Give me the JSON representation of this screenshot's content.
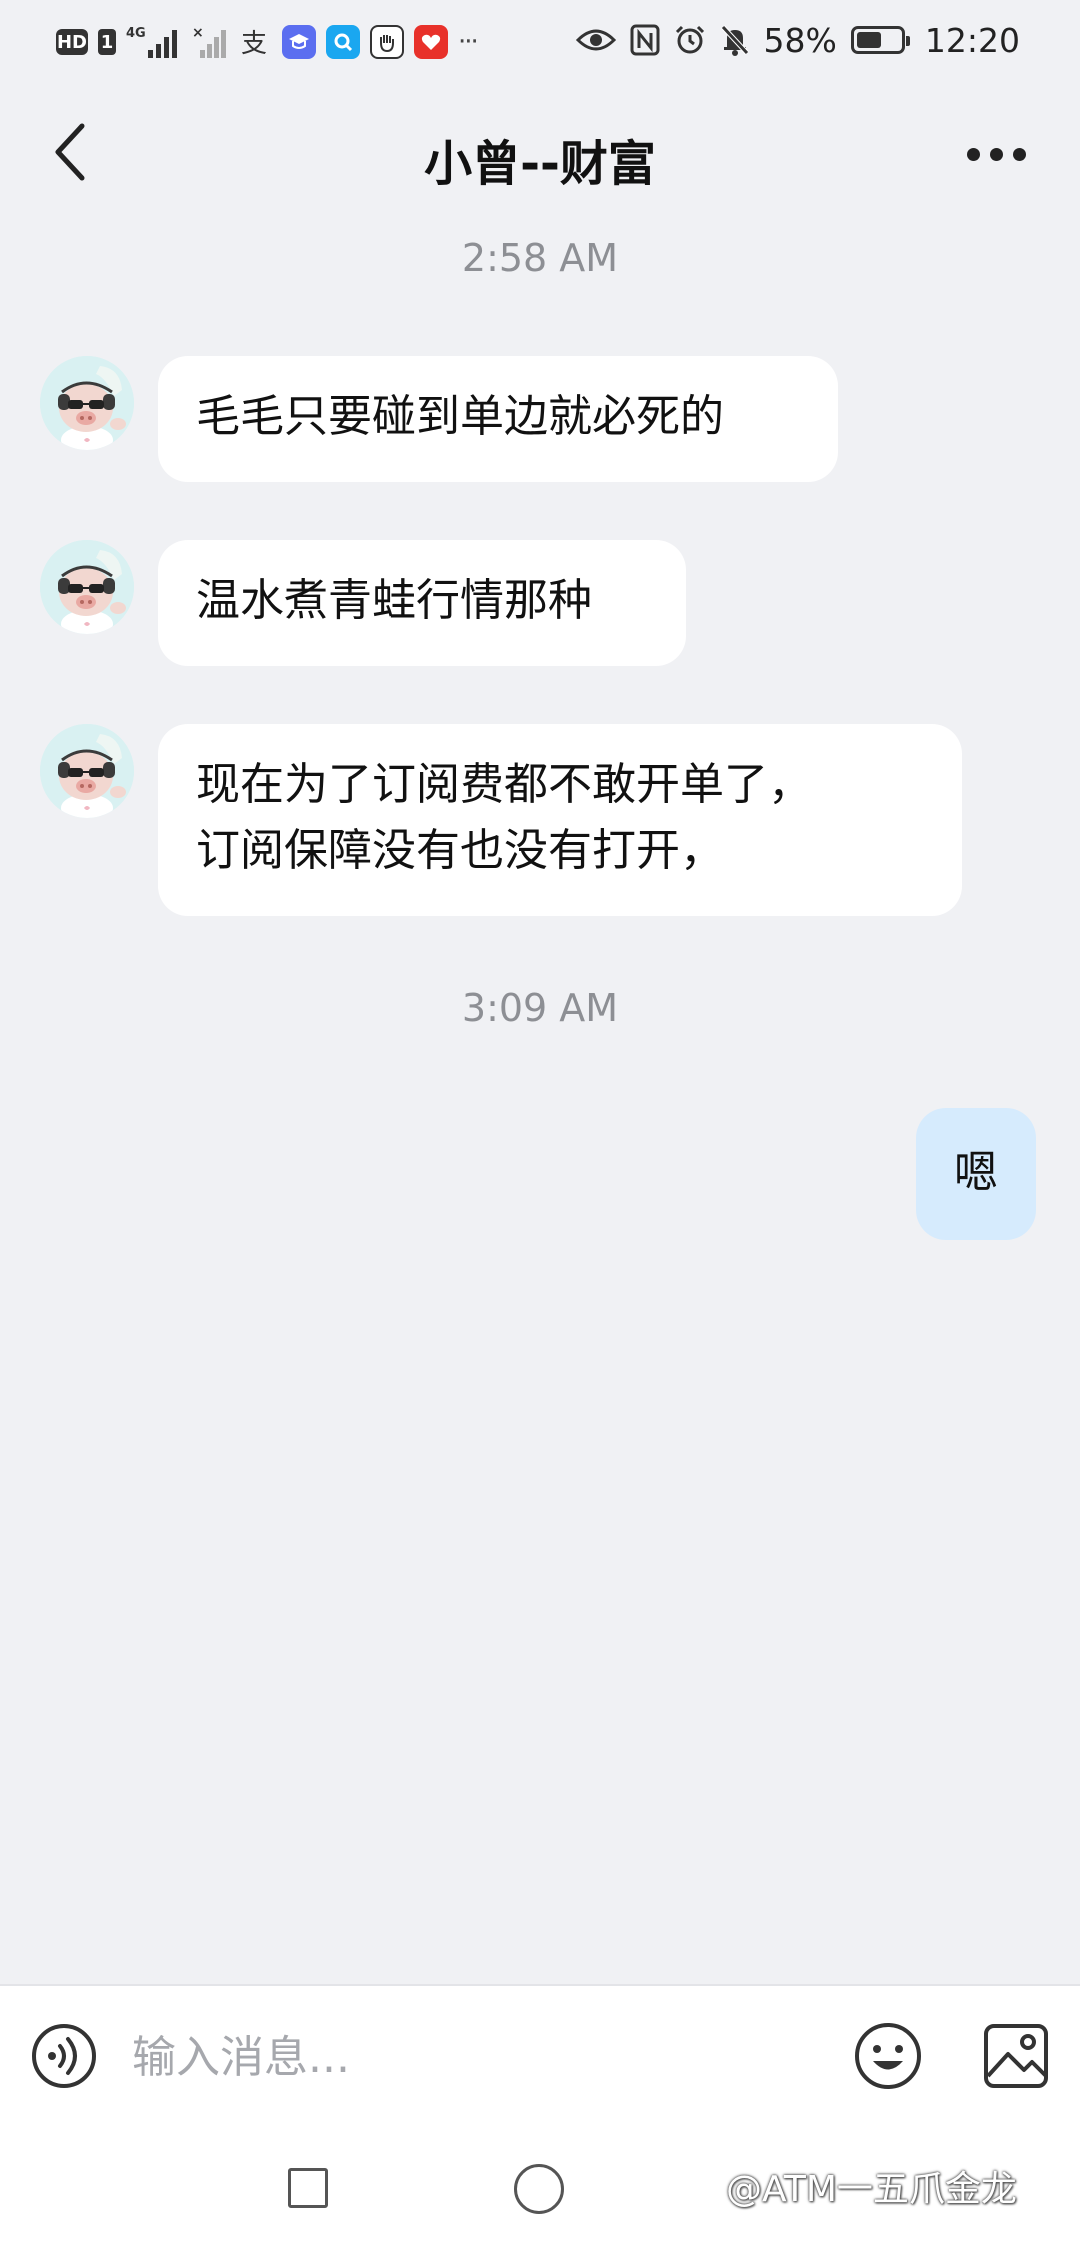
{
  "status_bar": {
    "hd_label": "HD",
    "sim_label": "1",
    "network_label": "4G",
    "alipay_icon": "alipay-icon",
    "battery_percent": "58%",
    "battery_level": 0.58,
    "time": "12:20",
    "overflow_label": "···"
  },
  "header": {
    "title": "小曾--财富"
  },
  "messages": [
    {
      "type": "timestamp",
      "text": "2:58 AM"
    },
    {
      "type": "incoming",
      "text": "毛毛只要碰到单边就必死的"
    },
    {
      "type": "incoming",
      "text": "温水煮青蛙行情那种"
    },
    {
      "type": "incoming",
      "text": "现在为了订阅费都不敢开单了，\n订阅保障没有也没有打开，"
    },
    {
      "type": "timestamp",
      "text": "3:09 AM"
    },
    {
      "type": "outgoing",
      "text": "嗯"
    }
  ],
  "input_bar": {
    "placeholder": "输入消息..."
  },
  "watermark": "@ATM一五爪金龙",
  "colors": {
    "background": "#f0f1f4",
    "incoming_bubble": "#ffffff",
    "outgoing_bubble": "#d6ebfd",
    "timestamp_text": "#8d8f94"
  }
}
